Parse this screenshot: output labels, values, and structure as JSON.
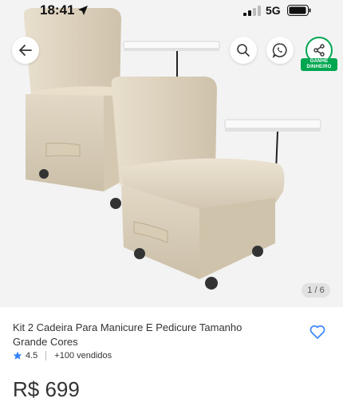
{
  "status_bar": {
    "time": "18:41",
    "network": "5G",
    "icons": [
      "location-arrow-icon",
      "signal-icon",
      "battery-icon"
    ]
  },
  "gallery": {
    "counter": "1 / 6",
    "background": "#f3f3f3"
  },
  "toolbar": {
    "back_icon": "arrow-left-icon",
    "search_icon": "search-icon",
    "whatsapp_icon": "whatsapp-icon",
    "share_icon": "share-icon",
    "share_tag": "GANHE DINHEIRO",
    "share_color": "#00a650"
  },
  "product": {
    "title": "Kit 2 Cadeira Para Manicure E Pedicure Tamanho Grande Cores",
    "rating": "4.5",
    "rating_color": "#3483fa",
    "sold": "+100 vendidos",
    "price": "R$ 699",
    "favorite_icon": "heart-icon",
    "favorite_color": "#3483fa"
  }
}
